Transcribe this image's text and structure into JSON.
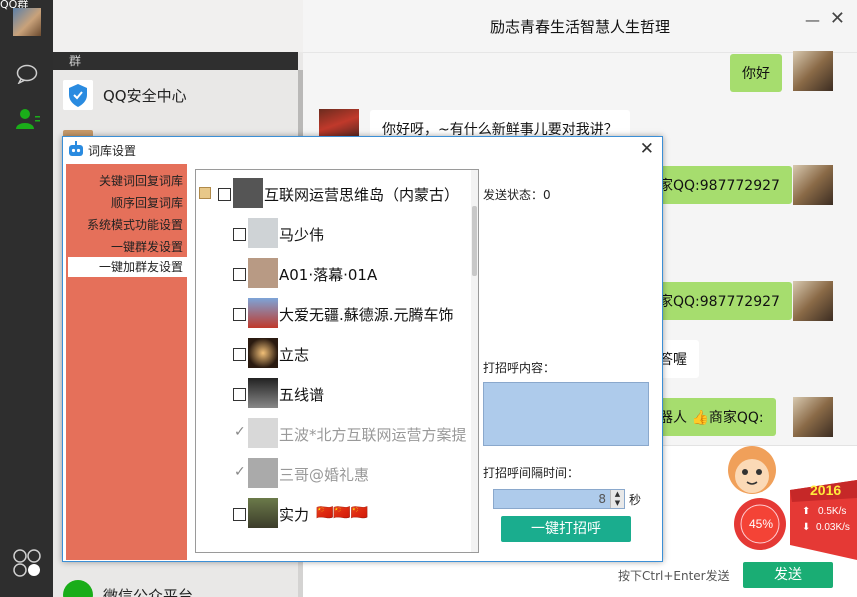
{
  "rail": {
    "corner_text": "QQ群"
  },
  "list": {
    "group_header": "群",
    "items": [
      {
        "name": "QQ安全中心"
      },
      {
        "name": ""
      },
      {
        "name": "微信公众平台"
      }
    ]
  },
  "chat": {
    "title": "励志青春生活智慧人生哲理",
    "messages": [
      {
        "text": "你好"
      },
      {
        "text": "你好呀，~有什么新鲜事儿要对我讲？"
      },
      {
        "text": "家QQ:987772927"
      },
      {
        "text": "家QQ:987772927"
      },
      {
        "text": "答喔"
      },
      {
        "text": "器人 👍商家QQ:"
      }
    ],
    "hint": "按下Ctrl+Enter发送",
    "send": "发送"
  },
  "mascot": {
    "year": "2016",
    "percent": "45%",
    "up": "0.5K/s",
    "down": "0.03K/s"
  },
  "dialog": {
    "title": "词库设置",
    "menu": [
      "关键词回复词库",
      "顺序回复词库",
      "系统模式功能设置",
      "一键群发设置",
      "一键加群友设置"
    ],
    "root": "互联网运营思维岛（内蒙古）",
    "friends": [
      {
        "name": "马少伟",
        "checked": false
      },
      {
        "name": "A01·落幕·01A",
        "checked": false
      },
      {
        "name": "大爱无疆.蘇德源.元腾车饰",
        "checked": false
      },
      {
        "name": "立志",
        "checked": false
      },
      {
        "name": "五线谱",
        "checked": false
      },
      {
        "name": "王波*北方互联网运营方案提",
        "checked": true
      },
      {
        "name": "三哥@婚礼惠",
        "checked": true
      },
      {
        "name": "实力",
        "checked": false
      }
    ],
    "flags": "🇨🇳🇨🇳🇨🇳",
    "status": "发送状态：0",
    "greet_label": "打招呼内容：",
    "interval_label": "打招呼间隔时间：",
    "interval_value": "8",
    "interval_unit": "秒",
    "go": "一键打招呼"
  }
}
